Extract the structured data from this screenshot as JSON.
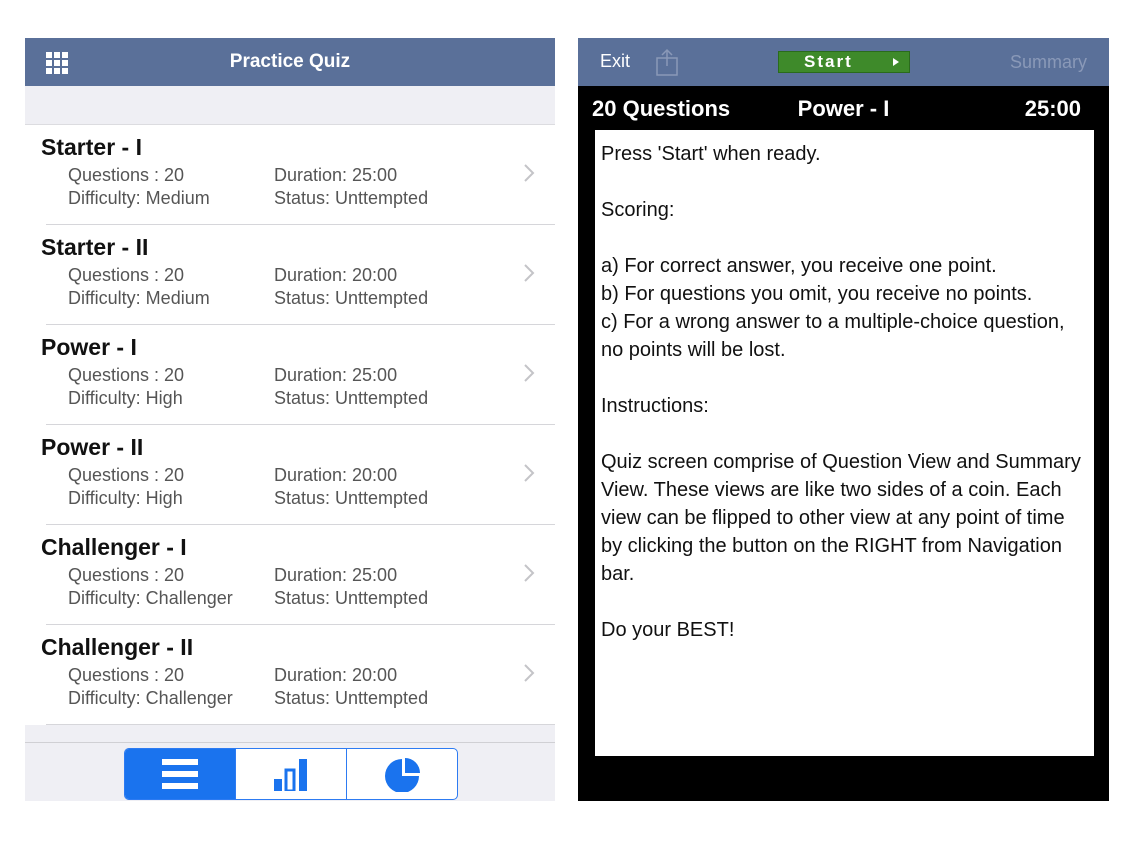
{
  "left": {
    "title": "Practice Quiz",
    "quizzes": [
      {
        "name": "Starter - I",
        "questions": "Questions : 20",
        "difficulty": "Difficulty: Medium",
        "duration": "Duration: 25:00",
        "status": "Status: Unttempted"
      },
      {
        "name": "Starter - II",
        "questions": "Questions : 20",
        "difficulty": "Difficulty: Medium",
        "duration": "Duration: 20:00",
        "status": "Status: Unttempted"
      },
      {
        "name": "Power - I",
        "questions": "Questions : 20",
        "difficulty": "Difficulty: High",
        "duration": "Duration: 25:00",
        "status": "Status: Unttempted"
      },
      {
        "name": "Power - II",
        "questions": "Questions : 20",
        "difficulty": "Difficulty: High",
        "duration": "Duration: 20:00",
        "status": "Status: Unttempted"
      },
      {
        "name": "Challenger - I",
        "questions": "Questions : 20",
        "difficulty": "Difficulty: Challenger",
        "duration": "Duration: 25:00",
        "status": "Status: Unttempted"
      },
      {
        "name": "Challenger - II",
        "questions": "Questions : 20",
        "difficulty": "Difficulty: Challenger",
        "duration": "Duration: 20:00",
        "status": "Status: Unttempted"
      }
    ],
    "tabs": [
      "list-icon",
      "bar-chart-icon",
      "pie-chart-icon"
    ]
  },
  "right": {
    "exit_label": "Exit",
    "start_label": "Start",
    "summary_label": "Summary",
    "question_count": "20 Questions",
    "quiz_name": "Power - I",
    "timer": "25:00",
    "lines": {
      "l1": "Press 'Start' when ready.",
      "l2": "Scoring:",
      "l3": "a) For correct answer, you receive one point.",
      "l4": "b) For questions you omit, you receive no points.",
      "l5": "c) For a wrong answer to a multiple-choice question, no points will be lost.",
      "l6": "Instructions:",
      "l7": "Quiz screen comprise of Question View and Summary View. These views are like two sides of a coin. Each view can be flipped to other view at any point of time by clicking the button on the RIGHT from Navigation bar.",
      "l8": "Do your BEST!"
    }
  },
  "colors": {
    "navbar": "#5a7099",
    "accent": "#1a73ee",
    "start_green": "#3e8a2a"
  }
}
